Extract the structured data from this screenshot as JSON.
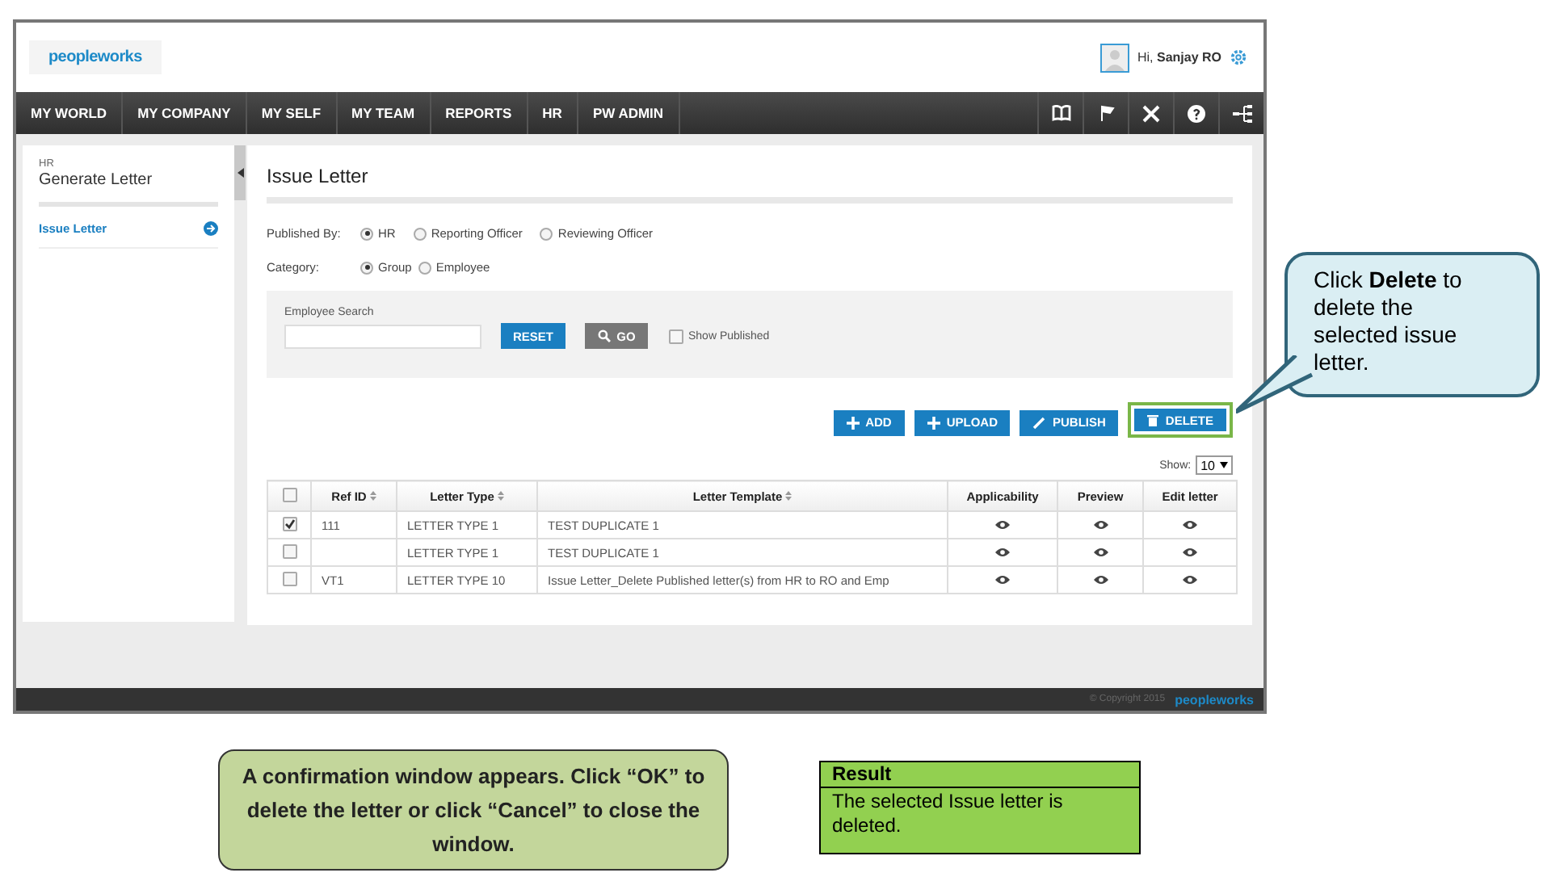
{
  "header": {
    "logo": "peopleworks",
    "greeting": "Hi,",
    "user": "Sanjay RO"
  },
  "nav": {
    "items": [
      "MY WORLD",
      "MY COMPANY",
      "MY SELF",
      "MY TEAM",
      "REPORTS",
      "HR",
      "PW ADMIN"
    ]
  },
  "sidebar": {
    "section": "HR",
    "title": "Generate Letter",
    "items": [
      {
        "label": "Issue Letter",
        "selected": true
      }
    ]
  },
  "page": {
    "title": "Issue Letter",
    "published_by": {
      "label": "Published By:",
      "options": [
        {
          "label": "HR",
          "selected": true
        },
        {
          "label": "Reporting Officer",
          "selected": false
        },
        {
          "label": "Reviewing Officer",
          "selected": false
        }
      ]
    },
    "category": {
      "label": "Category:",
      "options": [
        {
          "label": "Group",
          "selected": true
        },
        {
          "label": "Employee",
          "selected": false
        }
      ]
    },
    "search": {
      "label": "Employee Search",
      "reset": "RESET",
      "go": "GO",
      "show_published": {
        "label": "Show Published",
        "checked": false
      }
    },
    "actions": [
      {
        "label": "ADD",
        "kind": "add",
        "highlighted": false
      },
      {
        "label": "UPLOAD",
        "kind": "upload",
        "highlighted": false
      },
      {
        "label": "PUBLISH",
        "kind": "publish",
        "highlighted": false
      },
      {
        "label": "DELETE",
        "kind": "delete",
        "highlighted": true
      }
    ],
    "show": {
      "label": "Show:",
      "value": "10"
    },
    "table": {
      "all_checked": false,
      "columns": [
        {
          "label": "Ref ID",
          "sortable": true
        },
        {
          "label": "Letter Type",
          "sortable": true
        },
        {
          "label": "Letter Template",
          "sortable": true
        },
        {
          "label": "Applicability",
          "sortable": false
        },
        {
          "label": "Preview",
          "sortable": false
        },
        {
          "label": "Edit letter",
          "sortable": false
        }
      ],
      "rows": [
        {
          "checked": true,
          "ref_id": "111",
          "letter_type": "LETTER TYPE 1",
          "template": "TEST DUPLICATE 1"
        },
        {
          "checked": false,
          "ref_id": "",
          "letter_type": "LETTER TYPE 1",
          "template": "TEST DUPLICATE 1"
        },
        {
          "checked": false,
          "ref_id": "VT1",
          "letter_type": "LETTER TYPE 10",
          "template": "Issue Letter_Delete Published letter(s) from HR to RO and Emp"
        }
      ]
    }
  },
  "footer": {
    "copyright": "© Copyright 2015",
    "logo": "peopleworks"
  },
  "callout": {
    "text": "Click **Delete** to delete the selected issue letter."
  },
  "note": {
    "text": "A confirmation window appears. Click “OK” to delete the letter or click “Cancel” to close the window."
  },
  "result": {
    "title": "Result",
    "text": "The selected Issue letter is deleted."
  }
}
